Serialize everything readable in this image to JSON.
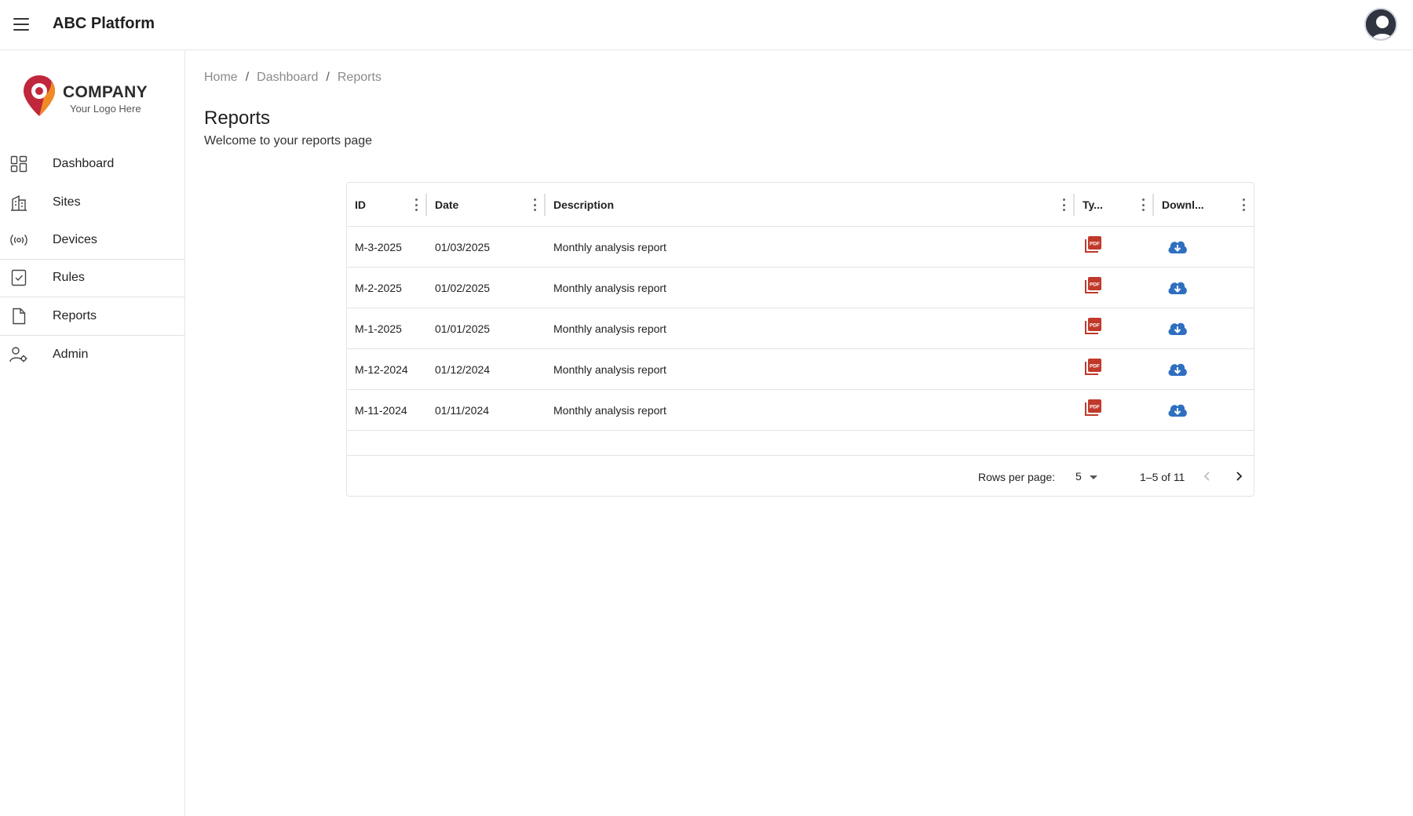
{
  "app": {
    "title": "ABC Platform",
    "menu_icon": "menu-icon",
    "avatar_icon": "user-avatar-icon"
  },
  "logo": {
    "company": "COMPANY",
    "tagline": "Your Logo Here"
  },
  "sidebar": {
    "items": [
      {
        "label": "Dashboard",
        "icon": "dashboard-grid-icon"
      },
      {
        "label": "Sites",
        "icon": "building-icon"
      },
      {
        "label": "Devices",
        "icon": "broadcast-icon"
      },
      {
        "label": "Rules",
        "icon": "checklist-icon"
      },
      {
        "label": "Reports",
        "icon": "document-icon"
      },
      {
        "label": "Admin",
        "icon": "user-gear-icon"
      }
    ]
  },
  "breadcrumb": {
    "items": [
      "Home",
      "Dashboard",
      "Reports"
    ],
    "separator": "/"
  },
  "page": {
    "title": "Reports",
    "subtitle": "Welcome to your reports page"
  },
  "table": {
    "columns": [
      "ID",
      "Date",
      "Description",
      "Ty...",
      "Downl..."
    ],
    "rows": [
      {
        "id": "M-3-2025",
        "date": "01/03/2025",
        "description": "Monthly analysis report",
        "type_icon": "pdf-icon",
        "download_icon": "cloud-download-icon"
      },
      {
        "id": "M-2-2025",
        "date": "01/02/2025",
        "description": "Monthly analysis report",
        "type_icon": "pdf-icon",
        "download_icon": "cloud-download-icon"
      },
      {
        "id": "M-1-2025",
        "date": "01/01/2025",
        "description": "Monthly analysis report",
        "type_icon": "pdf-icon",
        "download_icon": "cloud-download-icon"
      },
      {
        "id": "M-12-2024",
        "date": "01/12/2024",
        "description": "Monthly analysis report",
        "type_icon": "pdf-icon",
        "download_icon": "cloud-download-icon"
      },
      {
        "id": "M-11-2024",
        "date": "01/11/2024",
        "description": "Monthly analysis report",
        "type_icon": "pdf-icon",
        "download_icon": "cloud-download-icon"
      }
    ],
    "pagination": {
      "rows_per_page_label": "Rows per page:",
      "rows_per_page_value": "5",
      "range": "1–5 of 11"
    }
  },
  "colors": {
    "pdf_red": "#c0392b",
    "download_blue": "#2f6fc0",
    "logo_red": "#c0273c",
    "logo_orange": "#f08a24"
  }
}
